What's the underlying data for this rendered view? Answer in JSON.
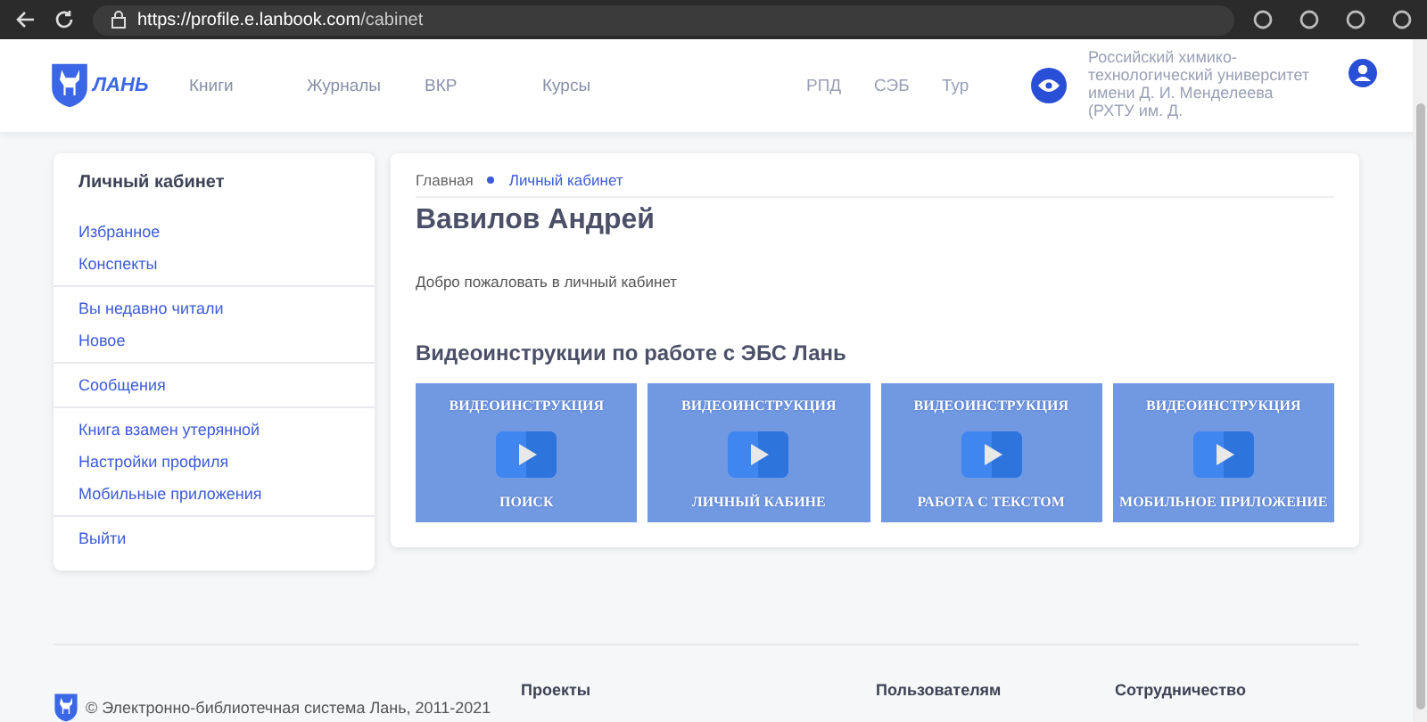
{
  "browser": {
    "url_host": "https://profile.e.lanbook.com",
    "url_path": "/cabinet"
  },
  "header": {
    "logo_text": "ЛАНЬ",
    "nav": [
      "Книги",
      "Журналы",
      "ВКР",
      "Курсы"
    ],
    "nav_right": [
      "РПД",
      "СЭБ",
      "Тур"
    ],
    "organization": "Российский химико-технологический университет имени Д. И. Менделеева (РХТУ им. Д."
  },
  "sidebar": {
    "title": "Личный кабинет",
    "groups": [
      [
        "Избранное",
        "Конспекты"
      ],
      [
        "Вы недавно читали",
        "Новое"
      ],
      [
        "Сообщения"
      ],
      [
        "Книга взамен утерянной",
        "Настройки профиля",
        "Мобильные приложения"
      ],
      [
        "Выйти"
      ]
    ]
  },
  "breadcrumbs": [
    "Главная",
    "Личный кабинет"
  ],
  "page_title": "Вавилов Андрей",
  "welcome": "Добро пожаловать в личный кабинет",
  "videos_title": "Видеоинструкции по работе с ЭБС Лань",
  "videos": [
    {
      "top": "ВИДЕОИНСТРУКЦИЯ",
      "bottom": "ПОИСК"
    },
    {
      "top": "ВИДЕОИНСТРУКЦИЯ",
      "bottom": "ЛИЧНЫЙ КАБИНЕ"
    },
    {
      "top": "ВИДЕОИНСТРУКЦИЯ",
      "bottom": "РАБОТА С ТЕКСТОМ"
    },
    {
      "top": "ВИДЕОИНСТРУКЦИЯ",
      "bottom": "МОБИЛЬНОЕ ПРИЛОЖЕНИЕ"
    }
  ],
  "footer": {
    "copyright": "© Электронно-библиотечная система Лань, 2011-2021",
    "columns": [
      "Проекты",
      "Пользователям",
      "Сотрудничество"
    ]
  }
}
